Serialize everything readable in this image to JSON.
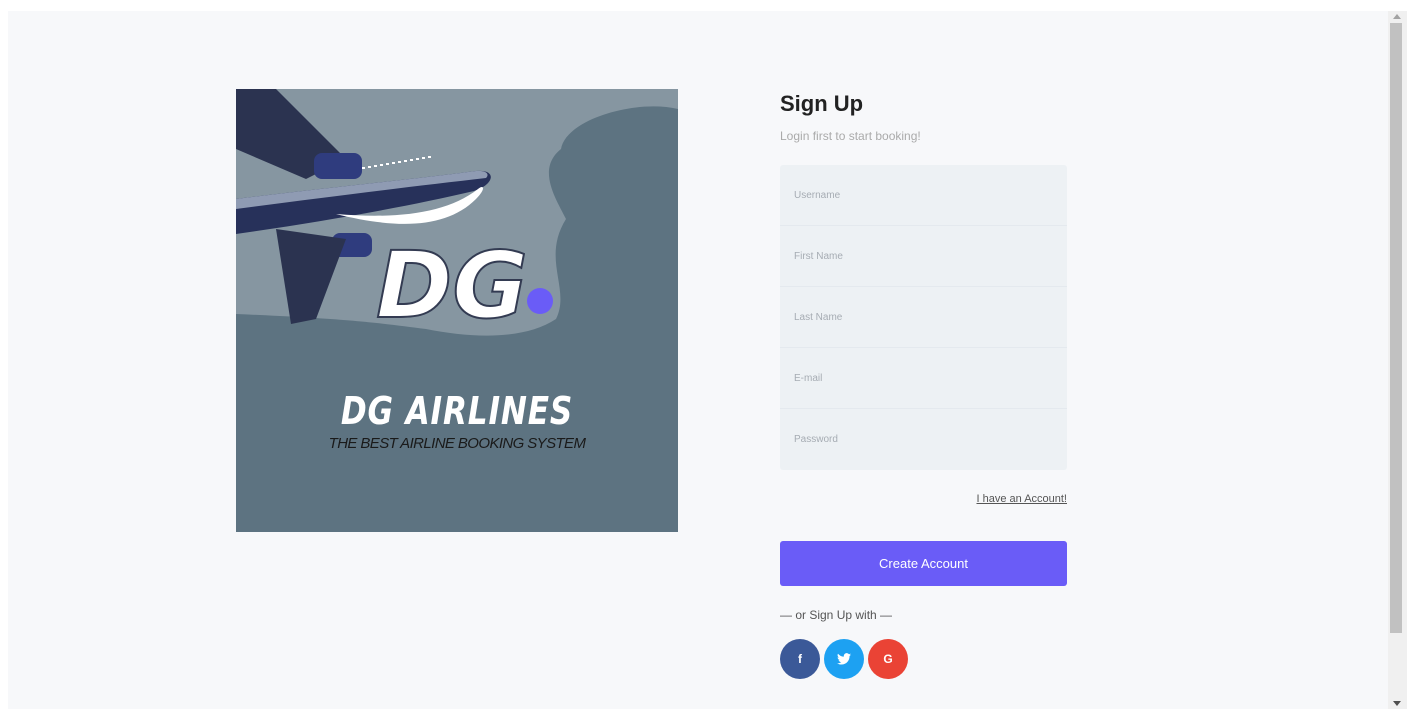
{
  "hero": {
    "brand_name": "DG AIRLINES",
    "tagline": "THE BEST AIRLINE BOOKING SYSTEM",
    "logo_text": "DG"
  },
  "form": {
    "title": "Sign Up",
    "subtitle": "Login first to start booking!",
    "fields": {
      "username_placeholder": "Username",
      "first_name_placeholder": "First Name",
      "last_name_placeholder": "Last Name",
      "email_placeholder": "E-mail",
      "password_placeholder": "Password"
    },
    "account_link": "I have an Account!",
    "create_button": "Create Account",
    "or_text": "— or Sign Up with —",
    "socials": {
      "facebook_glyph": "f",
      "twitter_glyph": "t",
      "google_glyph": "G"
    }
  },
  "colors": {
    "accent": "#6a5cf7",
    "facebook": "#3b5998",
    "twitter": "#1da1f2",
    "google": "#ea4335",
    "hero_bg": "#5d7381"
  }
}
